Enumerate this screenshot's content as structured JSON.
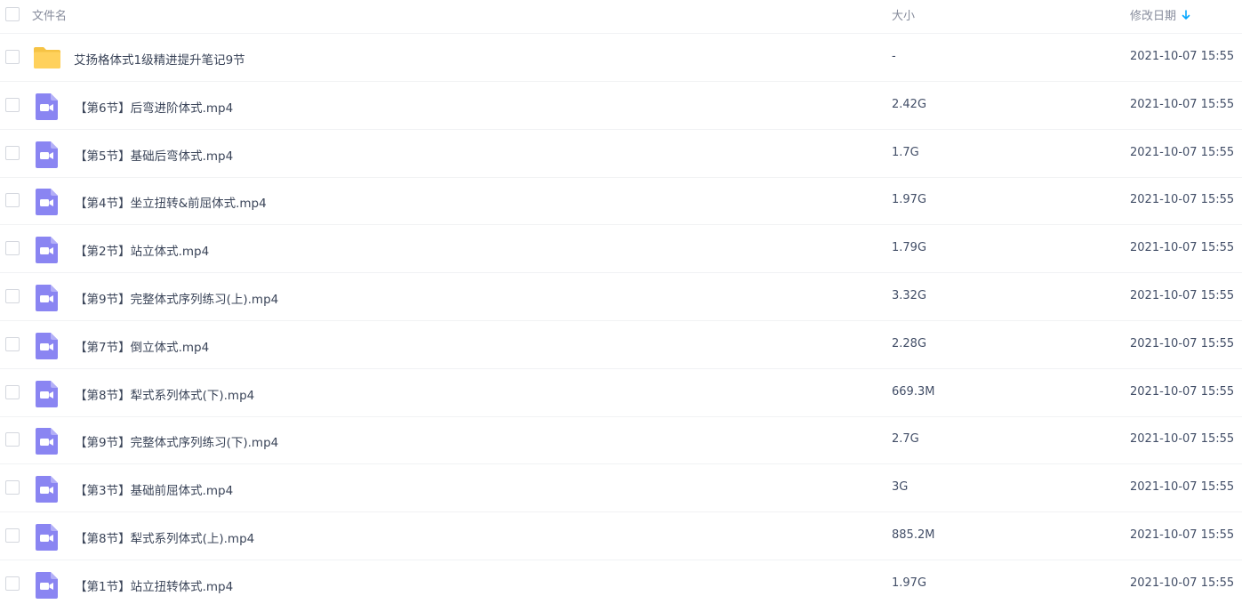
{
  "header": {
    "name_label": "文件名",
    "size_label": "大小",
    "date_label": "修改日期",
    "sort_icon": "arrow-down-icon",
    "accent_color": "#06a7ff"
  },
  "icon_colors": {
    "folder": "#ffd15c",
    "video": "#8a85f2"
  },
  "files": [
    {
      "type": "folder",
      "icon": "folder-icon",
      "name": "艾扬格体式1级精进提升笔记9节",
      "size": "-",
      "date": "2021-10-07 15:55"
    },
    {
      "type": "video",
      "icon": "video-file-icon",
      "name": "【第6节】后弯进阶体式.mp4",
      "size": "2.42G",
      "date": "2021-10-07 15:55"
    },
    {
      "type": "video",
      "icon": "video-file-icon",
      "name": "【第5节】基础后弯体式.mp4",
      "size": "1.7G",
      "date": "2021-10-07 15:55"
    },
    {
      "type": "video",
      "icon": "video-file-icon",
      "name": "【第4节】坐立扭转&前屈体式.mp4",
      "size": "1.97G",
      "date": "2021-10-07 15:55"
    },
    {
      "type": "video",
      "icon": "video-file-icon",
      "name": "【第2节】站立体式.mp4",
      "size": "1.79G",
      "date": "2021-10-07 15:55"
    },
    {
      "type": "video",
      "icon": "video-file-icon",
      "name": "【第9节】完整体式序列练习(上).mp4",
      "size": "3.32G",
      "date": "2021-10-07 15:55"
    },
    {
      "type": "video",
      "icon": "video-file-icon",
      "name": "【第7节】倒立体式.mp4",
      "size": "2.28G",
      "date": "2021-10-07 15:55"
    },
    {
      "type": "video",
      "icon": "video-file-icon",
      "name": "【第8节】犁式系列体式(下).mp4",
      "size": "669.3M",
      "date": "2021-10-07 15:55"
    },
    {
      "type": "video",
      "icon": "video-file-icon",
      "name": "【第9节】完整体式序列练习(下).mp4",
      "size": "2.7G",
      "date": "2021-10-07 15:55"
    },
    {
      "type": "video",
      "icon": "video-file-icon",
      "name": "【第3节】基础前屈体式.mp4",
      "size": "3G",
      "date": "2021-10-07 15:55"
    },
    {
      "type": "video",
      "icon": "video-file-icon",
      "name": "【第8节】犁式系列体式(上).mp4",
      "size": "885.2M",
      "date": "2021-10-07 15:55"
    },
    {
      "type": "video",
      "icon": "video-file-icon",
      "name": "【第1节】站立扭转体式.mp4",
      "size": "1.97G",
      "date": "2021-10-07 15:55"
    }
  ]
}
